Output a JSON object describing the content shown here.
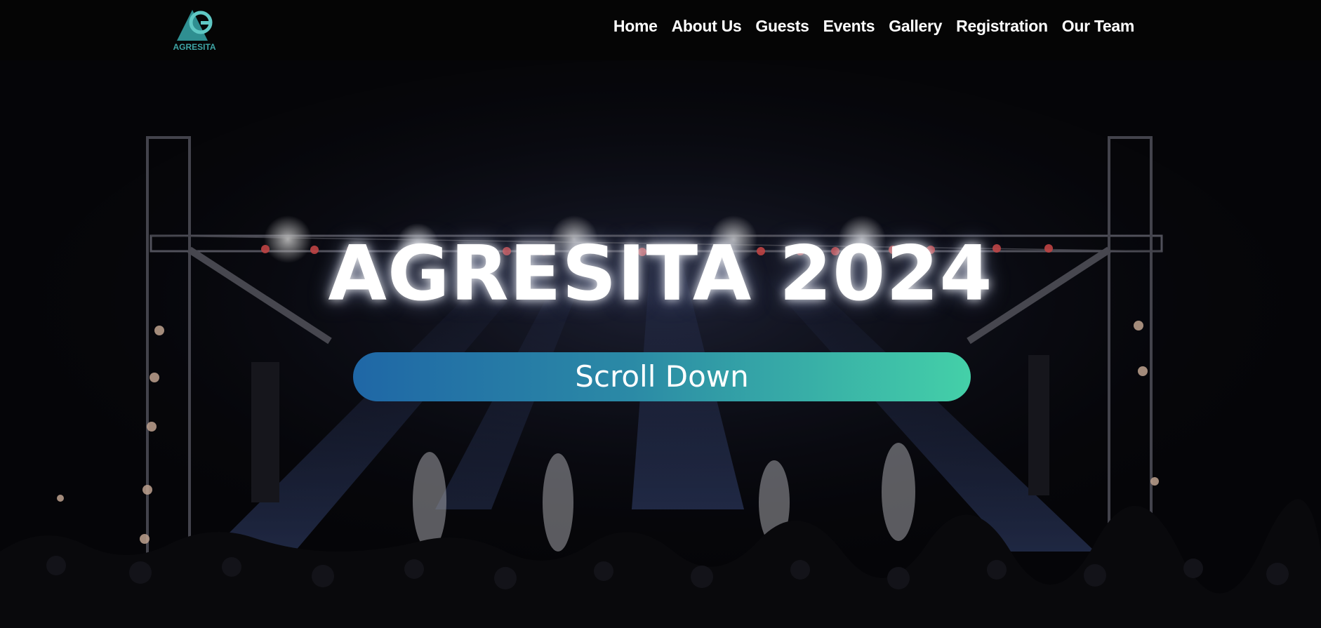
{
  "brand": {
    "logo_text": "AGRESITA",
    "logo_icon": "agresita-logo-icon",
    "logo_color": "#3fa6a6"
  },
  "nav": {
    "items": [
      {
        "label": "Home"
      },
      {
        "label": "About Us"
      },
      {
        "label": "Guests"
      },
      {
        "label": "Events"
      },
      {
        "label": "Gallery"
      },
      {
        "label": "Registration"
      },
      {
        "label": "Our Team"
      }
    ]
  },
  "hero": {
    "title": "AGRESITA 2024",
    "button_label": "Scroll Down",
    "button_gradient": [
      "#1f67a6",
      "#44d0a8"
    ]
  }
}
